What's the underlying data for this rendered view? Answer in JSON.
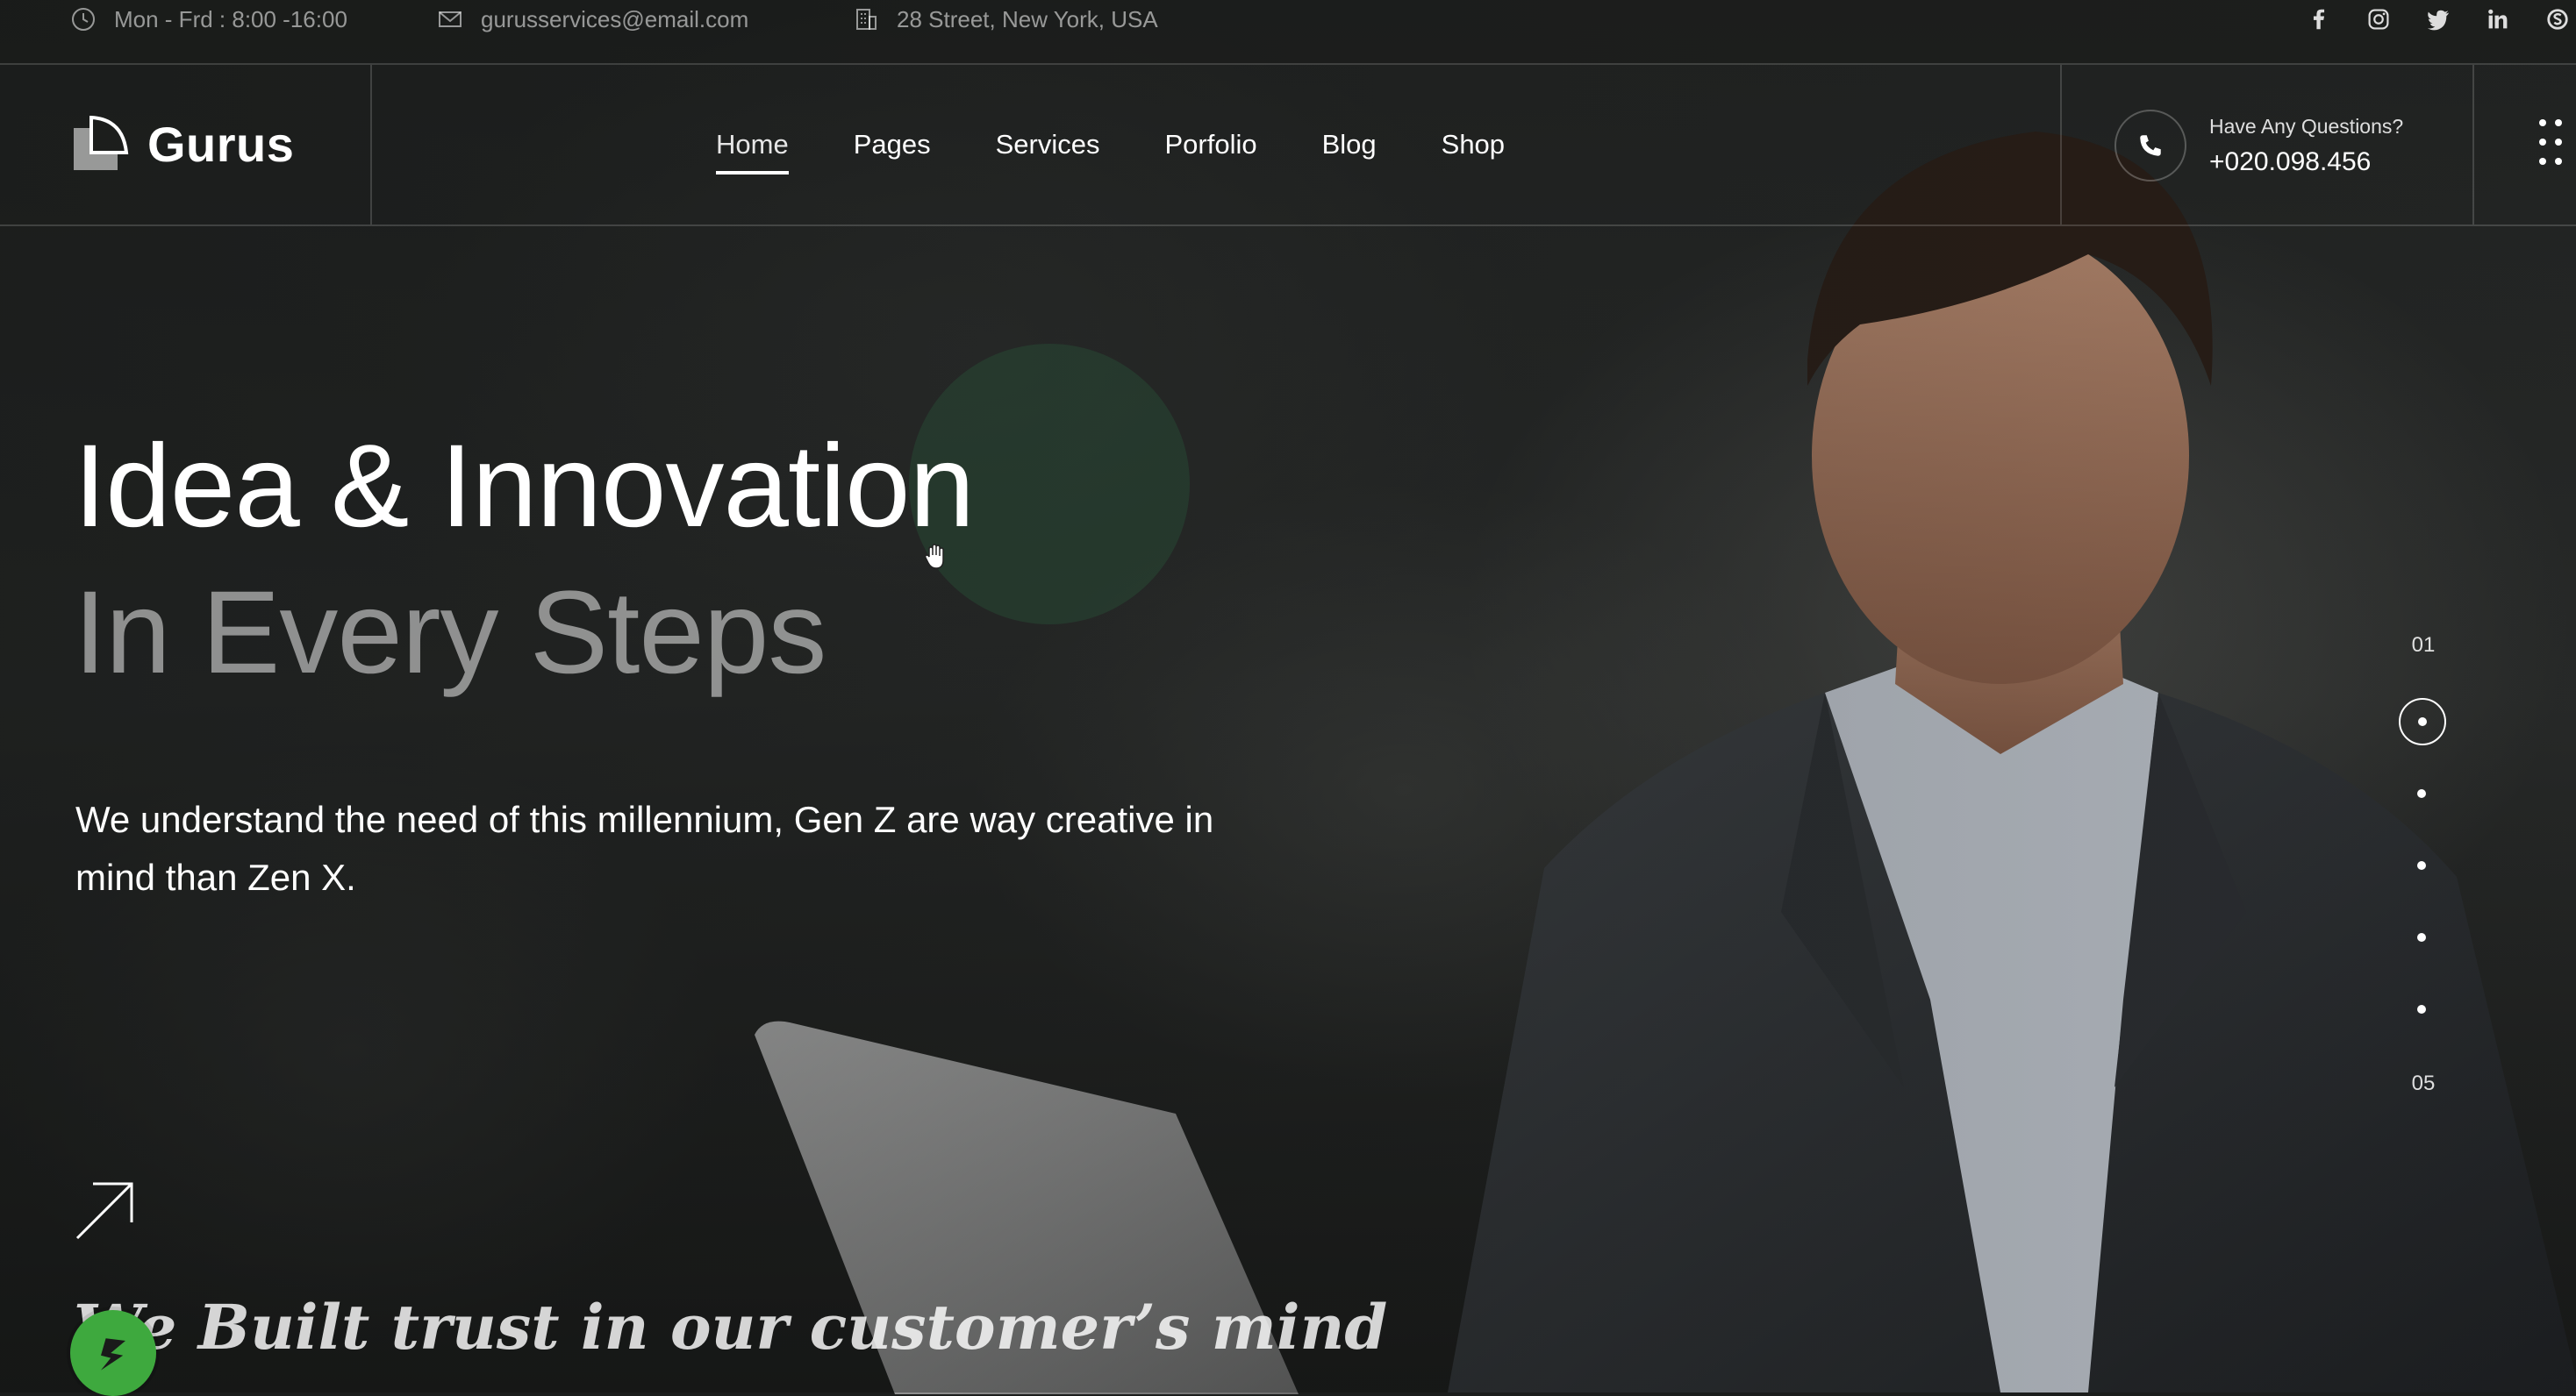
{
  "topbar": {
    "hours": "Mon - Frd : 8:00 -16:00",
    "email": "gurusservices@email.com",
    "address": "28 Street, New York, USA",
    "social_icons": [
      "facebook-icon",
      "instagram-icon",
      "twitter-icon",
      "linkedin-icon",
      "skype-icon"
    ]
  },
  "header": {
    "brand": "Gurus",
    "nav": [
      {
        "label": "Home",
        "active": true
      },
      {
        "label": "Pages"
      },
      {
        "label": "Services"
      },
      {
        "label": "Porfolio"
      },
      {
        "label": "Blog"
      },
      {
        "label": "Shop"
      }
    ],
    "contact": {
      "question": "Have Any Questions?",
      "phone": "+020.098.456"
    }
  },
  "hero": {
    "title_line1": "Idea & Innovation",
    "title_line2": "In Every Steps",
    "description": "We understand the need of this millennium, Gen Z are way creative in mind than Zen X.",
    "tagline": "We Built trust in our customer’s mind"
  },
  "slider": {
    "first": "01",
    "last": "05",
    "active_index": 1,
    "count": 5
  },
  "colors": {
    "accent_green": "#3ea93e",
    "text": "#ffffff"
  }
}
